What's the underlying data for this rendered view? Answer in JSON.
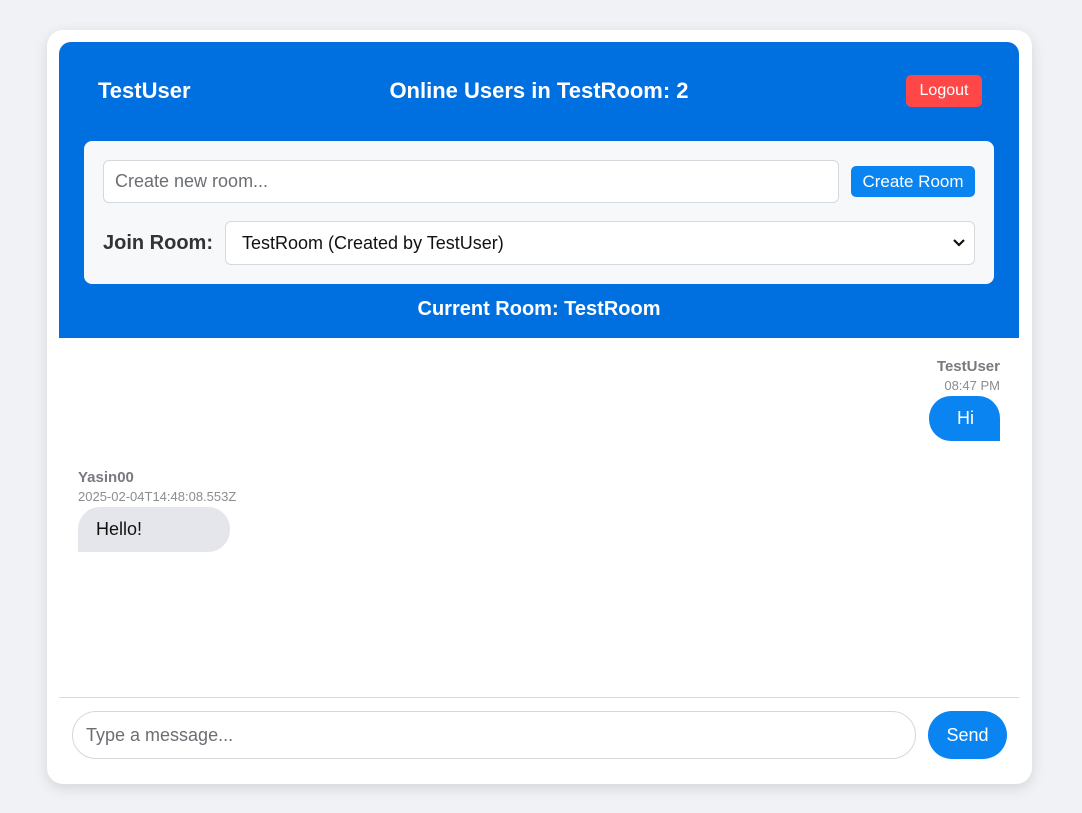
{
  "header": {
    "username": "TestUser",
    "online_title": "Online Users in TestRoom: 2",
    "logout_label": "Logout"
  },
  "room_panel": {
    "create_placeholder": "Create new room...",
    "create_label": "Create Room",
    "join_label": "Join Room:",
    "selected_room": "TestRoom (Created by TestUser)"
  },
  "current_room": "Current Room: TestRoom",
  "messages": [
    {
      "sender": "TestUser",
      "time": "08:47 PM",
      "text": "Hi",
      "own": true
    },
    {
      "sender": "Yasin00",
      "time": "2025-02-04T14:48:08.553Z",
      "text": "Hello!",
      "own": false
    }
  ],
  "composer": {
    "placeholder": "Type a message...",
    "send_label": "Send"
  },
  "colors": {
    "header_bg": "#006fdf",
    "accent": "#0a84f0",
    "logout": "#ff4747",
    "incoming_bubble": "#e4e6eb"
  }
}
